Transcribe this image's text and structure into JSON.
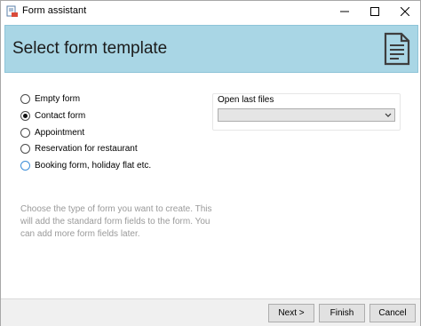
{
  "window": {
    "title": "Form assistant"
  },
  "header": {
    "title": "Select form template",
    "icon": "document-icon",
    "background": "#a9d6e5"
  },
  "templates": {
    "options": [
      {
        "label": "Empty form",
        "selected": false
      },
      {
        "label": "Contact form",
        "selected": true
      },
      {
        "label": "Appointment",
        "selected": false
      },
      {
        "label": "Reservation for restaurant",
        "selected": false
      },
      {
        "label": "Booking form, holiday flat etc.",
        "selected": false
      }
    ]
  },
  "last_files": {
    "label": "Open last files",
    "value": ""
  },
  "hint": "Choose the type of form you want to create. This will add the standard form fields to the form. You can add more form fields later.",
  "footer": {
    "next_label": "Next >",
    "finish_label": "Finish",
    "cancel_label": "Cancel"
  }
}
